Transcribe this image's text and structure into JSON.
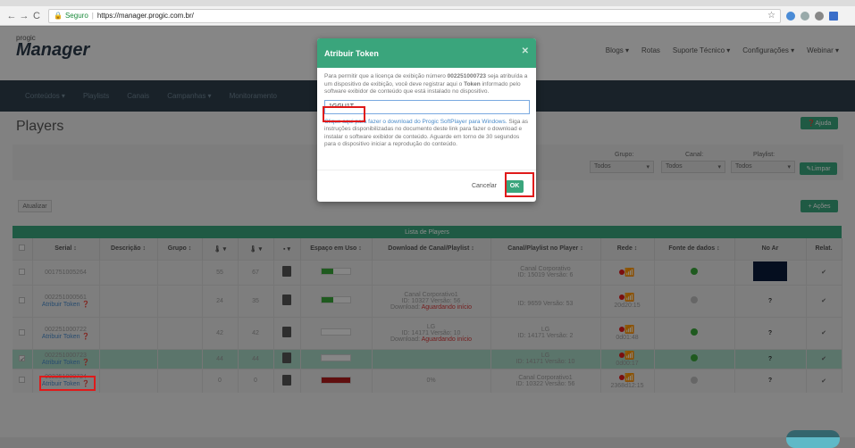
{
  "browser": {
    "secure_label": "Seguro",
    "url": "https://manager.progic.com.br/"
  },
  "header": {
    "logo_small": "progic",
    "logo_big": "Manager",
    "menu": [
      "Blogs ▾",
      "Rotas",
      "Suporte Técnico ▾",
      "Configurações ▾",
      "Webinar ▾"
    ]
  },
  "subnav": [
    "Conteúdos ▾",
    "Playlists",
    "Canais",
    "Campanhas ▾",
    "Monitoramento"
  ],
  "page": {
    "title": "Players",
    "help_button": "Ajuda",
    "filter_labels": {
      "grupo": "Grupo:",
      "canal": "Canal:",
      "playlist": "Playlist:"
    },
    "filter_values": {
      "grupo": "Todos",
      "canal": "Todos",
      "playlist": "Todos"
    },
    "limpar_button": "Limpar",
    "atualizar_button": "Atualizar",
    "acoes_button": "+ Ações",
    "list_title": "Lista de Players"
  },
  "table": {
    "headers": [
      "",
      "Serial ↕",
      "Descrição ↕",
      "Grupo ↕",
      "🌡 ▾",
      "🌡 ▾",
      "▪ ▾",
      "Espaço em Uso ↕",
      "Download de Canal/Playlist ↕",
      "Canal/Playlist no Player ↕",
      "Rede ↕",
      "Fonte de dados ↕",
      "No Ar",
      "Relat."
    ],
    "rows": [
      {
        "serial": "001751005264",
        "token": "",
        "desc": "",
        "grupo": "",
        "t1": "55",
        "t2": "67",
        "space": 0.4,
        "space_color": "#3aa53a",
        "dl": [
          "",
          "",
          ""
        ],
        "player": [
          "Canal Corporativo",
          "ID: 15019   Versão: 6"
        ],
        "rede": "",
        "fonte": "#3aa53a",
        "noar": "img",
        "relat": "✔",
        "selected": false
      },
      {
        "serial": "002251000561",
        "token": "Atribuir Token",
        "desc": "",
        "grupo": "",
        "t1": "24",
        "t2": "35",
        "space": 0.4,
        "space_color": "#3aa53a",
        "dl": [
          "Canal Corporativo1",
          "ID: 10327   Versão: 56",
          "Aguardando início"
        ],
        "player": [
          "",
          "ID: 9659   Versão: 53"
        ],
        "rede": "20d20:15",
        "fonte": "#bbbbbb",
        "noar": "?",
        "relat": "✔",
        "selected": false
      },
      {
        "serial": "002251000722",
        "token": "Atribuir Token",
        "desc": "",
        "grupo": "",
        "t1": "42",
        "t2": "42",
        "space": 0.0,
        "space_color": "#3aa53a",
        "dl": [
          "LG",
          "ID: 14171   Versão: 10",
          "Aguardando início"
        ],
        "player": [
          "LG",
          "ID: 14171   Versão: 2"
        ],
        "rede": "0d01:48",
        "fonte": "#3aa53a",
        "noar": "?",
        "relat": "✔",
        "selected": false
      },
      {
        "serial": "002251000723",
        "token": "Atribuir Token",
        "desc": "",
        "grupo": "",
        "t1": "44",
        "t2": "44",
        "space": 0.0,
        "space_color": "#3aa53a",
        "dl": [
          "",
          "",
          ""
        ],
        "player": [
          "LG",
          "ID: 14171   Versão: 10"
        ],
        "rede": "0d00:17",
        "fonte": "#3aa53a",
        "noar": "?",
        "relat": "✔",
        "selected": true
      },
      {
        "serial": "002251000724",
        "token": "Atribuir Token",
        "desc": "",
        "grupo": "",
        "t1": "0",
        "t2": "0",
        "space": 1.0,
        "space_color": "#b01c1c",
        "dl": [
          "0%",
          "",
          ""
        ],
        "player": [
          "Canal Corporativo1",
          "ID: 10322   Versão: 56"
        ],
        "rede": "2368d12:15",
        "fonte": "#bbbbbb",
        "noar": "?",
        "relat": "✔",
        "selected": false
      }
    ]
  },
  "modal": {
    "title": "Atribuir Token",
    "body_intro": "Para permitir que a licença de exibição número",
    "license": "002251000723",
    "body_mid": "seja atribuída a um dispositivo de exibição, você deve registrar aqui o",
    "token_word": "Token",
    "body_end": "informado pelo software exibidor de conteúdo que está instalado no dispositivo.",
    "input_value": "1GGU1T",
    "download_link": "Clique aqui para fazer o download do Progic SoftPlayer para Windows.",
    "instructions": "Siga as instruções disponibilizadas no documento deste link para fazer o download e instalar o software exibidor de conteúdo. Aguarde em torno de 30 segundos para o dispositivo iniciar a reprodução do conteúdo.",
    "cancel_label": "Cancelar",
    "ok_label": "OK",
    "close_glyph": "✕"
  },
  "colors": {
    "accent": "#3aa57c",
    "subnav": "#2e3f4c",
    "highlight": "#e01a1a"
  }
}
